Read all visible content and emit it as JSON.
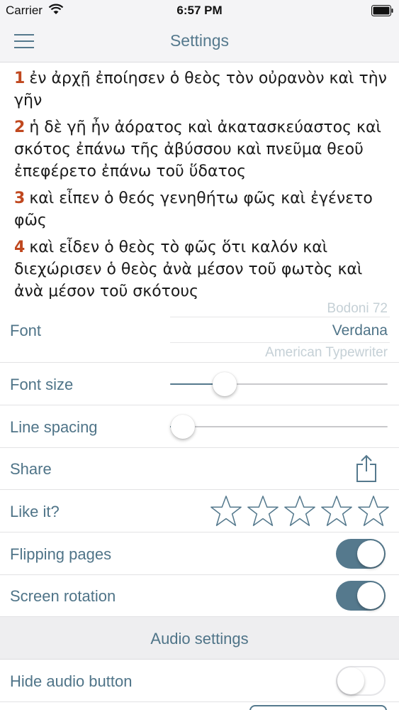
{
  "status_bar": {
    "carrier": "Carrier",
    "time": "6:57 PM"
  },
  "nav": {
    "title": "Settings",
    "menu_icon": "hamburger-menu-icon"
  },
  "verses": [
    {
      "num": "1",
      "text": "ἐν ἀρχῇ ἐποίησεν ὁ θεὸς τὸν οὐρανὸν καὶ τὴν γῆν"
    },
    {
      "num": "2",
      "text": "ἡ δὲ γῆ ἦν ἀόρατος καὶ ἀκατασκεύαστος καὶ σκότος ἐπάνω τῆς ἀβύσσου καὶ πνεῦμα θεοῦ ἐπεφέρετο ἐπάνω τοῦ ὕδατος"
    },
    {
      "num": "3",
      "text": "καὶ εἶπεν ὁ θεός γενηθήτω φῶς καὶ ἐγένετο φῶς"
    },
    {
      "num": "4",
      "text": "καὶ εἶδεν ὁ θεὸς τὸ φῶς ὅτι καλόν καὶ διεχώρισεν ὁ θεὸς ἀνὰ μέσον τοῦ φωτὸς καὶ ἀνὰ μέσον τοῦ σκότους"
    }
  ],
  "settings": {
    "font": {
      "label": "Font",
      "options": [
        "Bodoni 72",
        "Verdana",
        "American Typewriter"
      ],
      "selected": "Verdana"
    },
    "font_size": {
      "label": "Font size",
      "value": 0.25
    },
    "line_spacing": {
      "label": "Line spacing",
      "value": 0.06
    },
    "share": {
      "label": "Share",
      "icon": "share-icon"
    },
    "like": {
      "label": "Like it?",
      "stars_total": 5,
      "stars_filled": 0
    },
    "flipping_pages": {
      "label": "Flipping pages",
      "on": true
    },
    "screen_rotation": {
      "label": "Screen rotation",
      "on": true
    },
    "audio_header": "Audio settings",
    "hide_audio": {
      "label": "Hide audio button",
      "on": false
    }
  },
  "colors": {
    "accent": "#55798d",
    "verse_number": "#c0481f",
    "text": "#1a1a1a"
  }
}
